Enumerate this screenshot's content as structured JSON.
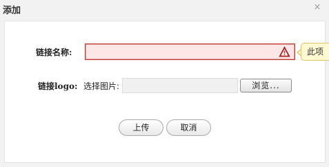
{
  "dialog": {
    "title": "添加",
    "close_glyph": "×"
  },
  "form": {
    "name_label": "链接名称:",
    "name_value": "",
    "name_error_tooltip": "此项",
    "logo_label": "链接logo:",
    "logo_hint": "选择图片:",
    "browse_label": "浏览..."
  },
  "actions": {
    "upload_label": "上传",
    "cancel_label": "取消"
  },
  "colors": {
    "error_border": "#c0392b",
    "error_bg": "#fde6e6",
    "tooltip_bg": "#fff9d1",
    "tooltip_border": "#e2c468",
    "warning_icon": "#c62828"
  },
  "icons": {
    "warning": "warning-triangle-icon",
    "close": "close-icon"
  }
}
